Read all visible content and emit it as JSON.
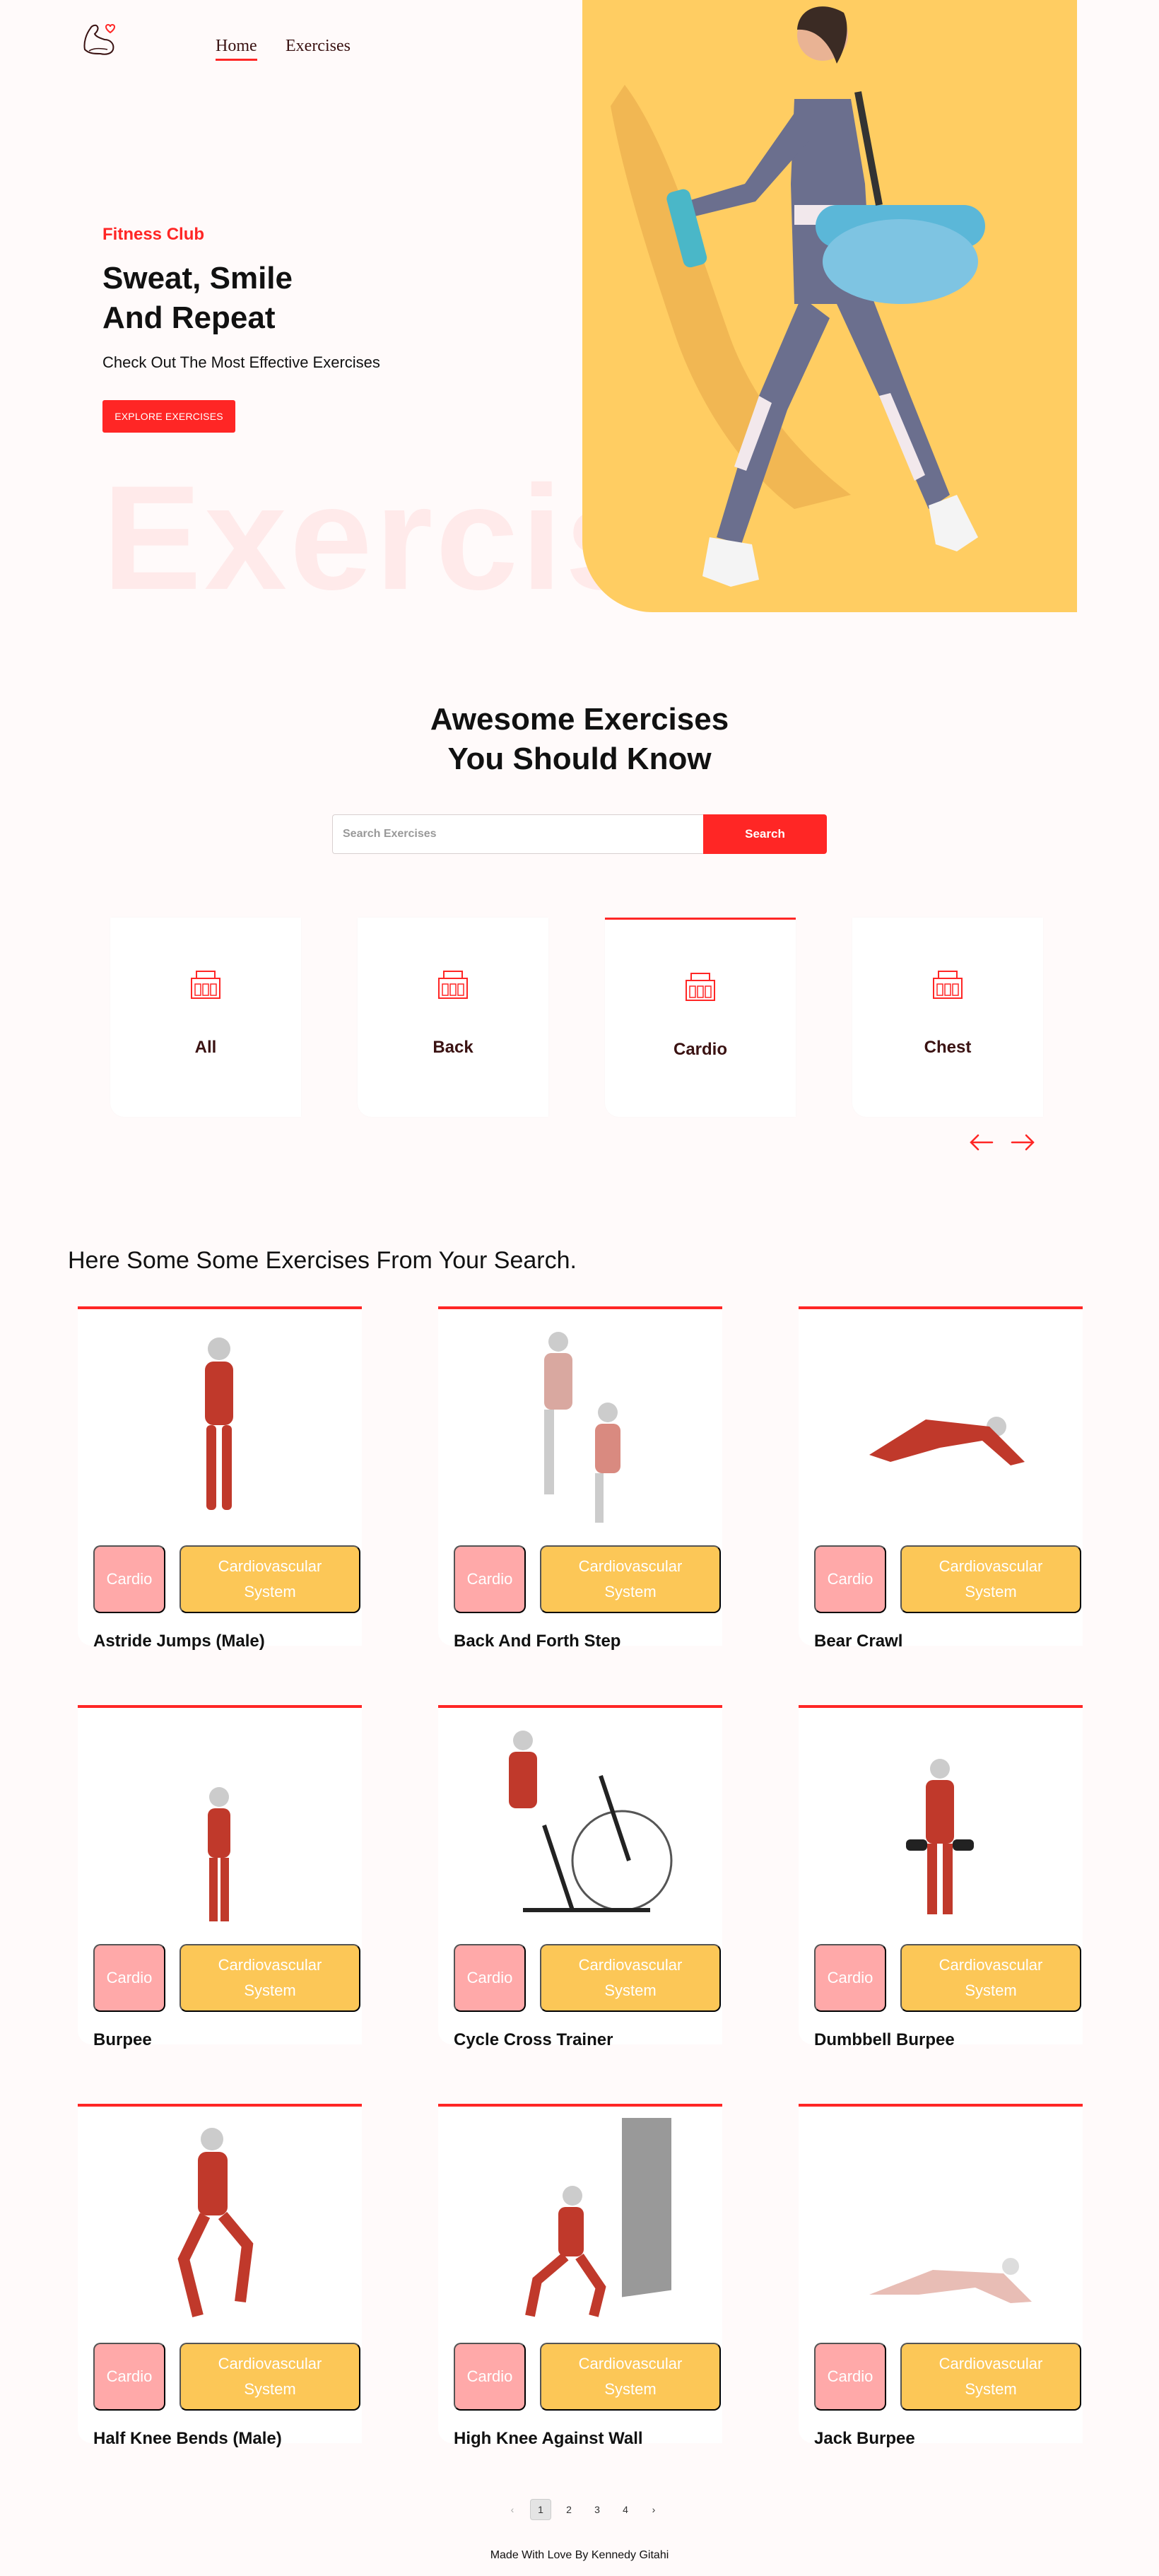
{
  "nav": {
    "home": "Home",
    "exercises": "Exercises"
  },
  "hero": {
    "subtitle": "Fitness Club",
    "title_line1": "Sweat, Smile",
    "title_line2": "And Repeat",
    "description": "Check Out The Most Effective Exercises",
    "button": "EXPLORE EXERCISES",
    "watermark": "Exercise"
  },
  "search": {
    "title_line1": "Awesome Exercises",
    "title_line2": "You Should Know",
    "placeholder": "Search Exercises",
    "button": "Search"
  },
  "categories": [
    {
      "label": "All"
    },
    {
      "label": "Back"
    },
    {
      "label": "Cardio"
    },
    {
      "label": "Chest"
    }
  ],
  "results": {
    "title": "Here Some Some Exercises From Your Search.",
    "items": [
      {
        "name": "Astride Jumps (Male)",
        "body_part": "Cardio",
        "target": "Cardiovascular System"
      },
      {
        "name": "Back And Forth Step",
        "body_part": "Cardio",
        "target": "Cardiovascular System"
      },
      {
        "name": "Bear Crawl",
        "body_part": "Cardio",
        "target": "Cardiovascular System"
      },
      {
        "name": "Burpee",
        "body_part": "Cardio",
        "target": "Cardiovascular System"
      },
      {
        "name": "Cycle Cross Trainer",
        "body_part": "Cardio",
        "target": "Cardiovascular System"
      },
      {
        "name": "Dumbbell Burpee",
        "body_part": "Cardio",
        "target": "Cardiovascular System"
      },
      {
        "name": "Half Knee Bends (Male)",
        "body_part": "Cardio",
        "target": "Cardiovascular System"
      },
      {
        "name": "High Knee Against Wall",
        "body_part": "Cardio",
        "target": "Cardiovascular System"
      },
      {
        "name": "Jack Burpee",
        "body_part": "Cardio",
        "target": "Cardiovascular System"
      }
    ]
  },
  "pagination": {
    "prev": "‹",
    "pages": [
      "1",
      "2",
      "3",
      "4"
    ],
    "next": "›",
    "current": "1"
  },
  "footer": "Made With Love By Kennedy Gitahi",
  "colors": {
    "accent": "#ff2625",
    "banner": "#ffcd62",
    "pill_body": "#ffa9a9",
    "pill_target": "#fcc757"
  }
}
